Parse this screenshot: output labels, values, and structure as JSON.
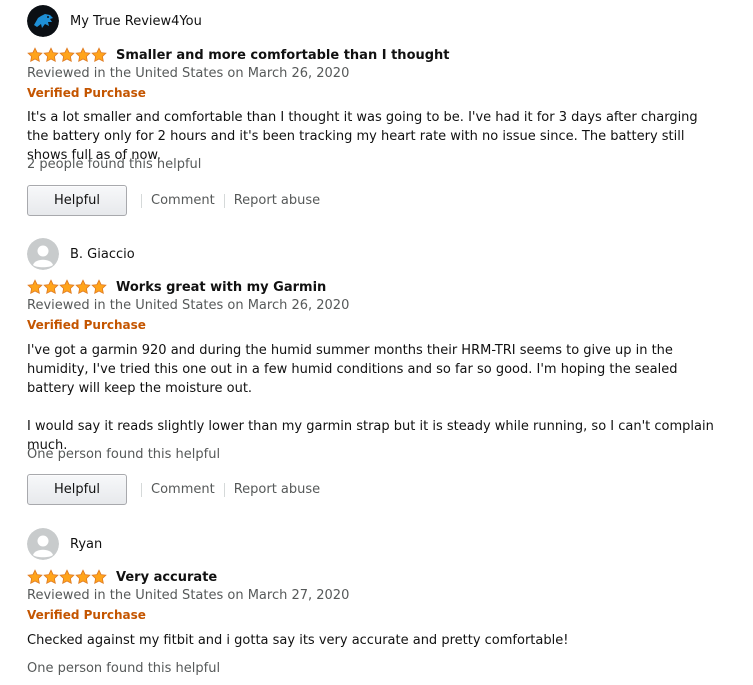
{
  "reviews": [
    {
      "name": "My True Review4You",
      "avatar_icon": "lions-logo-avatar",
      "rating": 5,
      "title": "Smaller and more comfortable than I thought",
      "meta": "Reviewed in the United States on March 26, 2020",
      "verified": "Verified Purchase",
      "body": [
        "It's a lot smaller and comfortable than I thought it was going to be. I've had it for 3 days after charging the battery only for 2 hours and it's been tracking my heart rate with no issue since. The battery still shows full as of now."
      ],
      "helpful_count": "2 people found this helpful",
      "helpful_label": "Helpful",
      "comment_label": "Comment",
      "report_label": "Report abuse"
    },
    {
      "name": "B. Giaccio",
      "avatar_icon": "default-user-avatar",
      "rating": 5,
      "title": "Works great with my Garmin",
      "meta": "Reviewed in the United States on March 26, 2020",
      "verified": "Verified Purchase",
      "body": [
        "I've got a garmin 920 and during the humid summer months their HRM-TRI seems to give up in the humidity, I've tried this one out in a few humid conditions and so far so good. I'm hoping the sealed battery will keep the moisture out.",
        "I would say it reads slightly lower than my garmin strap but it is steady while running, so I can't complain much."
      ],
      "helpful_count": "One person found this helpful",
      "helpful_label": "Helpful",
      "comment_label": "Comment",
      "report_label": "Report abuse"
    },
    {
      "name": "Ryan",
      "avatar_icon": "default-user-avatar",
      "rating": 5,
      "title": "Very accurate",
      "meta": "Reviewed in the United States on March 27, 2020",
      "verified": "Verified Purchase",
      "body": [
        "Checked against my fitbit and i gotta say its very accurate and pretty comfortable!"
      ],
      "helpful_count": "One person found this helpful"
    }
  ],
  "colors": {
    "star_fill": "#ffa41c",
    "star_stroke": "#de7921",
    "verified": "#c45500",
    "muted": "#565959"
  }
}
